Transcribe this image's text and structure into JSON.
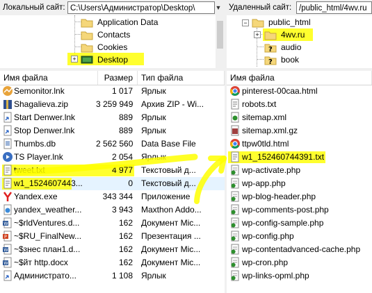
{
  "local": {
    "label": "Локальный сайт:",
    "path": "C:\\Users\\Администратор\\Desktop\\",
    "tree": [
      {
        "label": "Application Data",
        "icon": "folder-icon"
      },
      {
        "label": "Contacts",
        "icon": "folder-icon"
      },
      {
        "label": "Cookies",
        "icon": "folder-icon"
      },
      {
        "label": "Desktop",
        "icon": "desktop-icon"
      }
    ],
    "expander": "+",
    "columns": {
      "name": "Имя файла",
      "size": "Размер",
      "type": "Тип файла"
    },
    "files": [
      {
        "name": "Semonitor.lnk",
        "size": "1 017",
        "type": "Ярлык",
        "icon": "semonitor-icon"
      },
      {
        "name": "Shagalieva.zip",
        "size": "3 259 949",
        "type": "Архив ZIP - Wi...",
        "icon": "zip-icon"
      },
      {
        "name": "Start Denwer.lnk",
        "size": "889",
        "type": "Ярлык",
        "icon": "shortcut-icon"
      },
      {
        "name": "Stop Denwer.lnk",
        "size": "889",
        "type": "Ярлык",
        "icon": "shortcut-icon"
      },
      {
        "name": "Thumbs.db",
        "size": "2 562 560",
        "type": "Data Base File",
        "icon": "db-file-icon"
      },
      {
        "name": "TS Player.lnk",
        "size": "2 054",
        "type": "Ярлык",
        "icon": "player-icon"
      },
      {
        "name": "tweet.txt",
        "size": "4 977",
        "type": "Текстовый д...",
        "icon": "text-file-icon"
      },
      {
        "name": "w1_1524607443...",
        "size": "0",
        "type": "Текстовый д...",
        "icon": "text-file-icon"
      },
      {
        "name": "Yandex.exe",
        "size": "343 344",
        "type": "Приложение",
        "icon": "yandex-icon"
      },
      {
        "name": "yandex_weather...",
        "size": "3 943",
        "type": "Maxthon Addo...",
        "icon": "maxthon-icon"
      },
      {
        "name": "~$rldVentures.d...",
        "size": "162",
        "type": "Документ Mic...",
        "icon": "word-doc-icon"
      },
      {
        "name": "~$RU_FinalNew...",
        "size": "162",
        "type": "Презентация ...",
        "icon": "ppt-icon"
      },
      {
        "name": "~$знес план1.d...",
        "size": "162",
        "type": "Документ Mic...",
        "icon": "word-doc-icon"
      },
      {
        "name": "~$йт http.docx",
        "size": "162",
        "type": "Документ Mic...",
        "icon": "word-doc-icon"
      },
      {
        "name": "Администрато...",
        "size": "1 108",
        "type": "Ярлык",
        "icon": "shortcut-icon"
      }
    ]
  },
  "remote": {
    "label": "Удаленный сайт:",
    "path": "/public_html/4wv.ru",
    "tree": [
      {
        "label": "public_html",
        "icon": "folder-icon"
      },
      {
        "label": "4wv.ru",
        "icon": "folder-icon"
      },
      {
        "label": "audio",
        "icon": "unknown-folder-icon"
      },
      {
        "label": "book",
        "icon": "unknown-folder-icon"
      }
    ],
    "expander": "+",
    "collapser": "−",
    "columns": {
      "name": "Имя файла"
    },
    "files": [
      {
        "name": "pinterest-00caa.html",
        "icon": "chrome-html-icon"
      },
      {
        "name": "robots.txt",
        "icon": "text-file-icon"
      },
      {
        "name": "sitemap.xml",
        "icon": "xml-file-icon"
      },
      {
        "name": "sitemap.xml.gz",
        "icon": "archive-icon"
      },
      {
        "name": "ttpw0tld.html",
        "icon": "chrome-html-icon"
      },
      {
        "name": "w1_152460744391.txt",
        "icon": "text-file-icon"
      },
      {
        "name": "wp-activate.php",
        "icon": "php-file-icon"
      },
      {
        "name": "wp-app.php",
        "icon": "php-file-icon"
      },
      {
        "name": "wp-blog-header.php",
        "icon": "php-file-icon"
      },
      {
        "name": "wp-comments-post.php",
        "icon": "php-file-icon"
      },
      {
        "name": "wp-config-sample.php",
        "icon": "php-file-icon"
      },
      {
        "name": "wp-config.php",
        "icon": "php-file-icon"
      },
      {
        "name": "wp-contentadvanced-cache.php",
        "icon": "php-file-icon"
      },
      {
        "name": "wp-cron.php",
        "icon": "php-file-icon"
      },
      {
        "name": "wp-links-opml.php",
        "icon": "php-file-icon"
      }
    ]
  },
  "annotation": {
    "highlight_color": "#ffff00",
    "arrow_color": "#ffff00"
  }
}
